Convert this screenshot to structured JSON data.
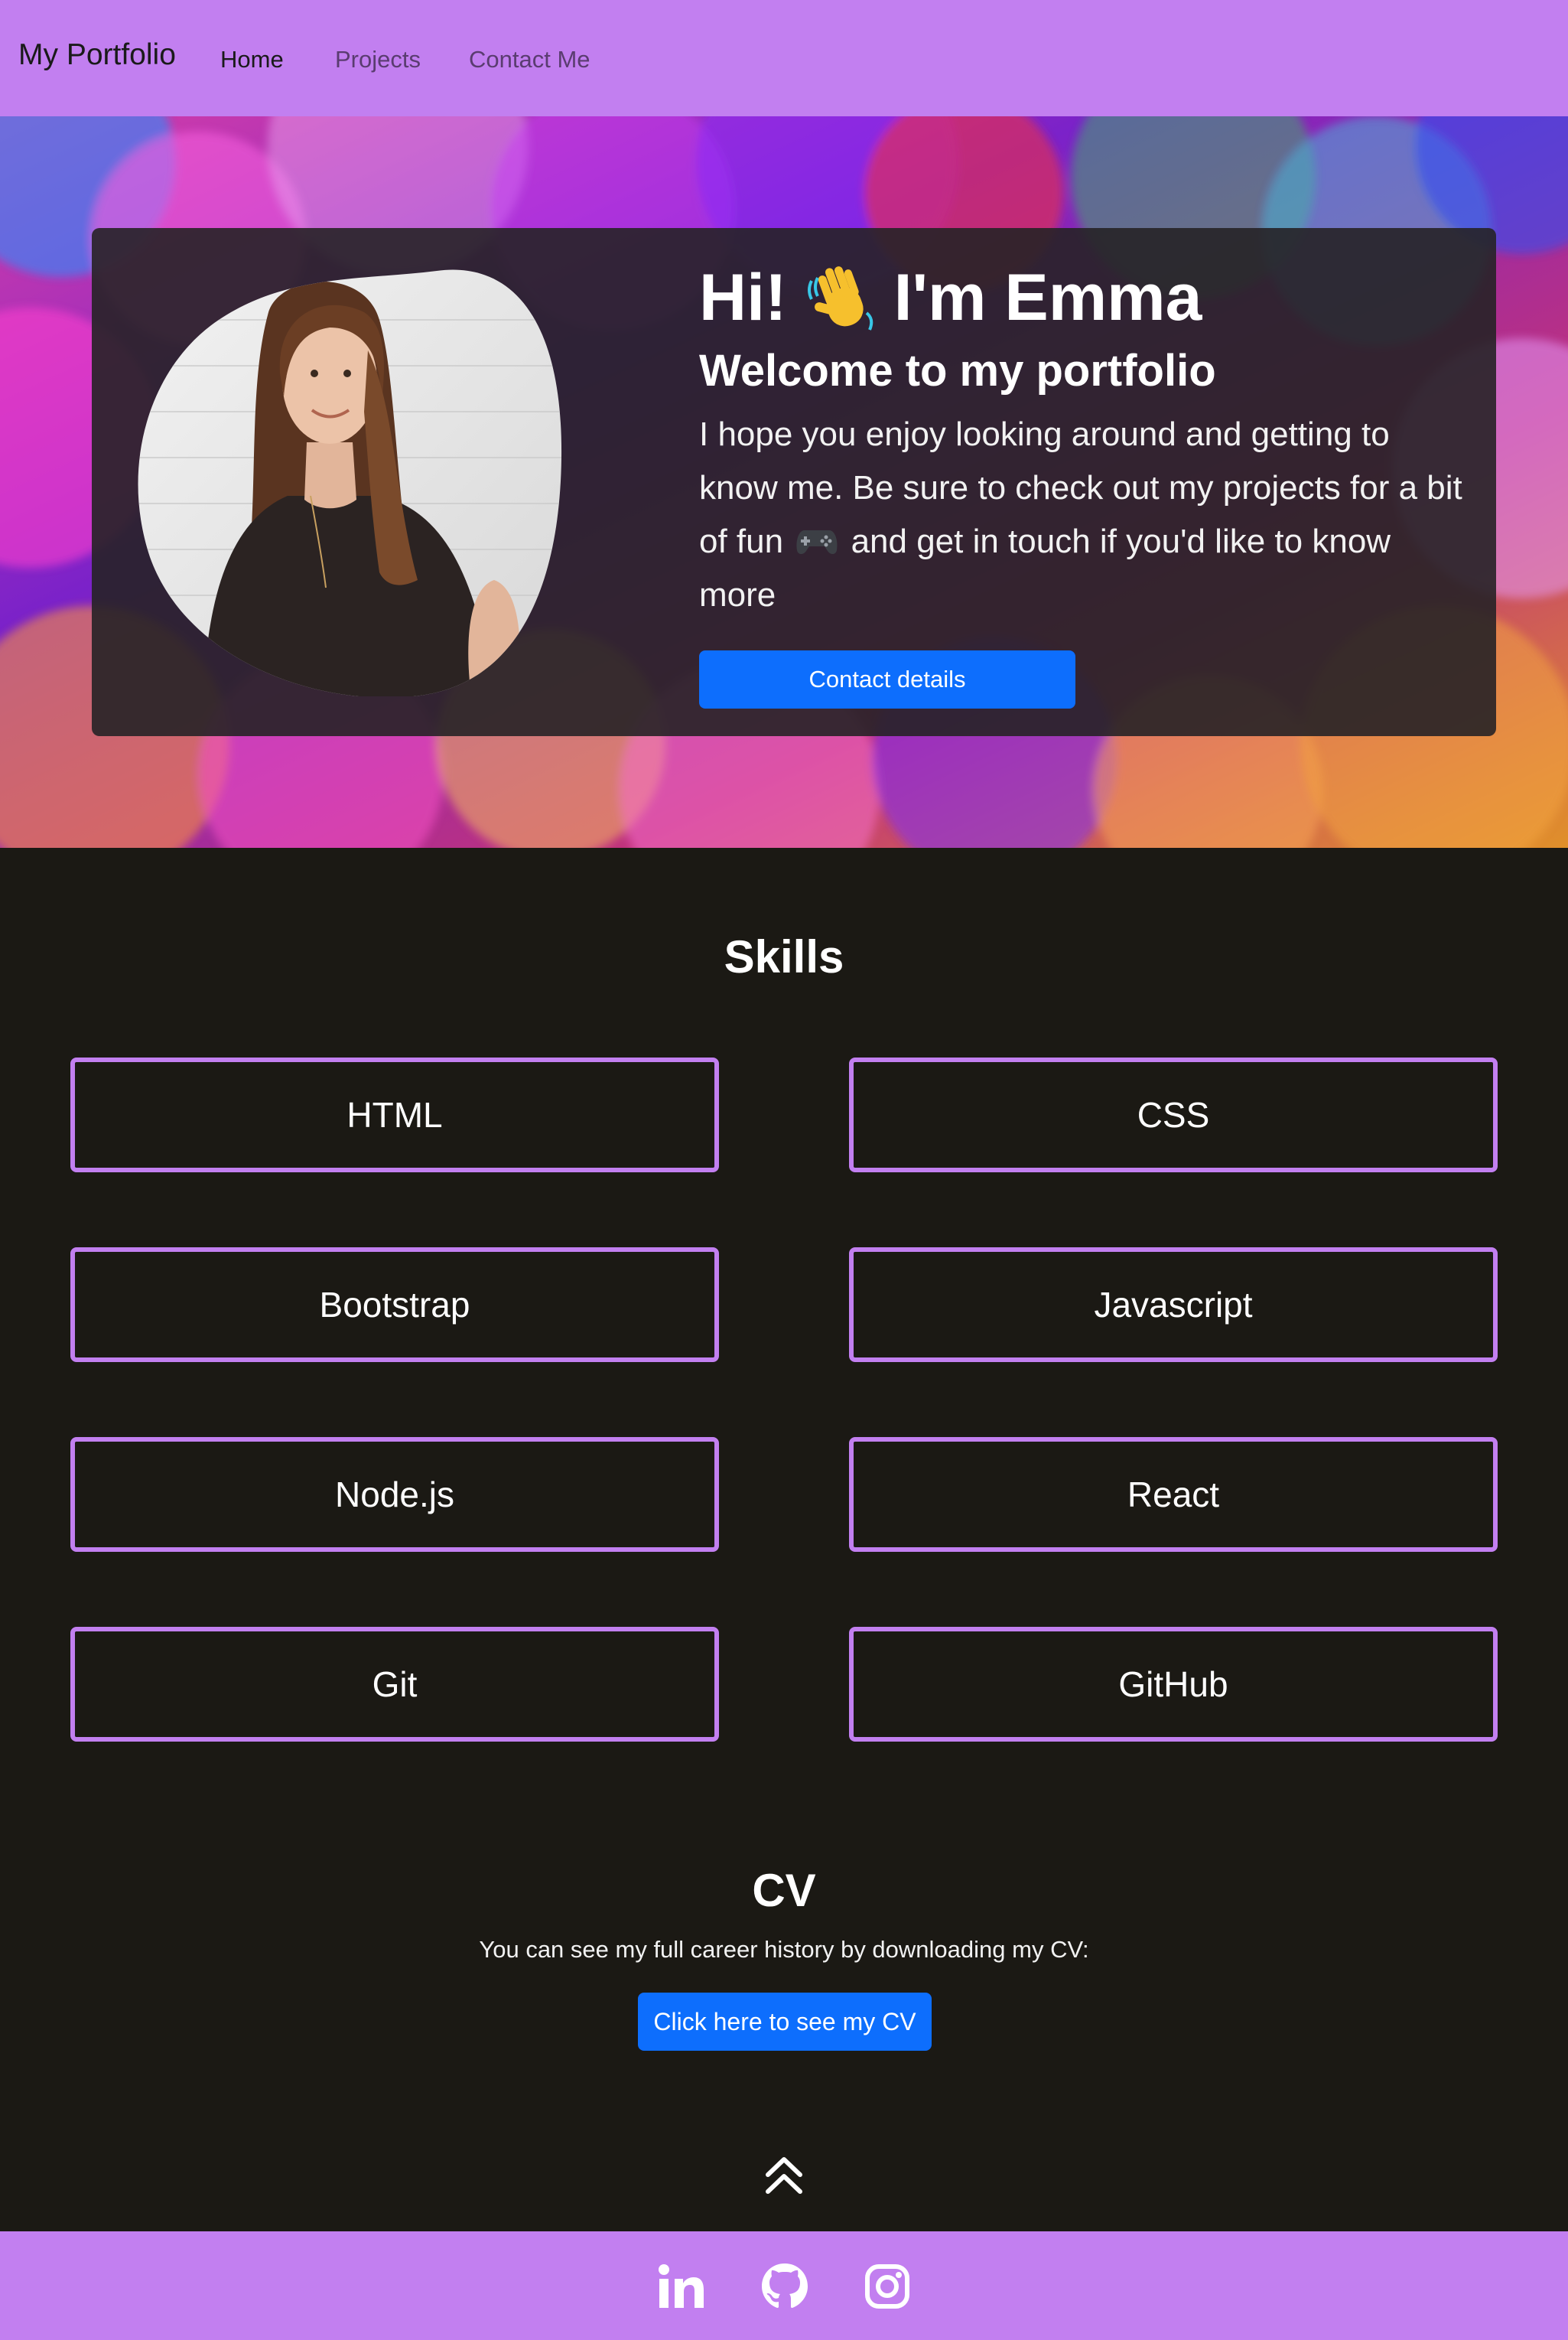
{
  "navbar": {
    "brand": "My Portfolio",
    "links": [
      {
        "label": "Home",
        "active": true
      },
      {
        "label": "Projects",
        "active": false
      },
      {
        "label": "Contact Me",
        "active": false
      }
    ],
    "bg_color": "#c27ff0"
  },
  "hero": {
    "title_prefix": "Hi!",
    "title_suffix": "I'm Emma",
    "wave_icon": "waving-hand-emoji",
    "subtitle": "Welcome to my portfolio",
    "para_part1": "I hope you enjoy looking around and getting to know me. Be sure to check out my projects for a bit of fun",
    "gamepad_icon": "gamepad-emoji",
    "para_part2": "and get in touch if you'd like to know more",
    "cta": "Contact details",
    "portrait": "profile-photo"
  },
  "skills": {
    "title": "Skills",
    "items": [
      "HTML",
      "CSS",
      "Bootstrap",
      "Javascript",
      "Node.js",
      "React",
      "Git",
      "GitHub"
    ],
    "border_color": "#c27ff0"
  },
  "cv": {
    "title": "CV",
    "text": "You can see my full career history by downloading my CV:",
    "button": "Click here to see my CV"
  },
  "back_to_top_icon": "double-chevron-up-icon",
  "footer": {
    "icons": [
      "linkedin-icon",
      "github-icon",
      "instagram-icon"
    ]
  },
  "colors": {
    "accent": "#c27ff0",
    "primary_button": "#0d6efd",
    "page_bg": "#1b1914"
  }
}
